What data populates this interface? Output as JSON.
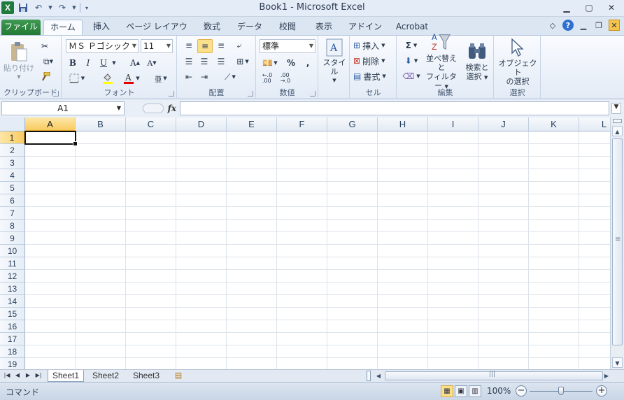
{
  "app": {
    "title": "Book1 - Microsoft Excel",
    "logo_letter": "X"
  },
  "tabs": [
    {
      "label": "ファイル"
    },
    {
      "label": "ホーム"
    },
    {
      "label": "挿入"
    },
    {
      "label": "ページ レイアウト"
    },
    {
      "label": "数式"
    },
    {
      "label": "データ"
    },
    {
      "label": "校閲"
    },
    {
      "label": "表示"
    },
    {
      "label": "アドイン"
    },
    {
      "label": "Acrobat"
    }
  ],
  "ribbon": {
    "clipboard": {
      "group": "クリップボード",
      "paste": "貼り付け"
    },
    "font": {
      "group": "フォント",
      "name": "ＭＳ Ｐゴシック",
      "size": "11",
      "bold": "B",
      "italic": "I",
      "underline": "U"
    },
    "alignment": {
      "group": "配置"
    },
    "number": {
      "group": "数値",
      "format": "標準",
      "percent": "%",
      "comma": ","
    },
    "styles": {
      "label": "スタイル"
    },
    "cells": {
      "group": "セル",
      "insert": "挿入",
      "delete": "削除",
      "format": "書式"
    },
    "editing": {
      "group": "編集",
      "sort_filter_1": "並べ替えと",
      "sort_filter_2": "フィルター",
      "find_select_1": "検索と",
      "find_select_2": "選択",
      "sum": "Σ"
    },
    "selection": {
      "group": "選択",
      "object_select_1": "オブジェクト",
      "object_select_2": "の選択"
    }
  },
  "formula_bar": {
    "name_box": "A1",
    "fx": "fx",
    "value": ""
  },
  "grid": {
    "columns": [
      "A",
      "B",
      "C",
      "D",
      "E",
      "F",
      "G",
      "H",
      "I",
      "J",
      "K",
      "L"
    ],
    "rows": [
      "1",
      "2",
      "3",
      "4",
      "5",
      "6",
      "7",
      "8",
      "9",
      "10",
      "11",
      "12",
      "13",
      "14",
      "15",
      "16",
      "17",
      "18",
      "19"
    ],
    "active_cell": "A1"
  },
  "sheets": [
    {
      "label": "Sheet1"
    },
    {
      "label": "Sheet2"
    },
    {
      "label": "Sheet3"
    }
  ],
  "status": {
    "mode": "コマンド",
    "zoom": "100%"
  }
}
